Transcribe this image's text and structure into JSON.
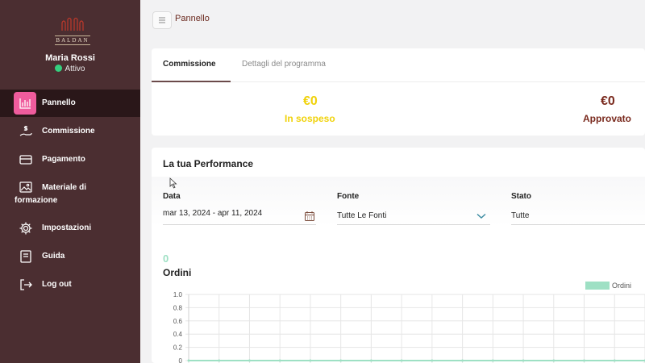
{
  "user": {
    "name": "Maria Rossi",
    "status": "Attivo"
  },
  "brand": {
    "name": "BALDAN"
  },
  "sidebar": {
    "items": [
      {
        "label": "Pannello",
        "icon": "bar-chart-icon",
        "active": true
      },
      {
        "label": "Commissione",
        "icon": "hand-money-icon"
      },
      {
        "label": "Pagamento",
        "icon": "credit-card-icon"
      },
      {
        "label": "Materiale di",
        "label_cont": "formazione",
        "icon": "image-icon"
      },
      {
        "label": "Impostazioni",
        "icon": "gear-icon"
      },
      {
        "label": "Guida",
        "icon": "book-icon"
      },
      {
        "label": "Log out",
        "icon": "logout-icon"
      }
    ]
  },
  "header": {
    "breadcrumb": "Pannello"
  },
  "commission": {
    "tabs": [
      "Commissione",
      "Dettagli del programma"
    ],
    "pending": {
      "amount": "€0",
      "label": "In sospeso",
      "color": "#f0d20a"
    },
    "approved": {
      "amount": "€0",
      "label": "Approvato",
      "color": "#7a2a1e"
    }
  },
  "performance": {
    "title": "La tua Performance",
    "filters": {
      "date": {
        "label": "Data",
        "value": "mar 13, 2024 - apr 11, 2024"
      },
      "source": {
        "label": "Fonte",
        "value": "Tutte Le Fonti"
      },
      "state": {
        "label": "Stato",
        "value": "Tutte"
      }
    },
    "orders_count": "0",
    "orders_title": "Ordini"
  },
  "chart_data": {
    "type": "line",
    "series": [
      {
        "name": "Ordini",
        "color": "#9ee0c4",
        "values": [
          0,
          0,
          0,
          0,
          0,
          0,
          0,
          0,
          0,
          0,
          0,
          0,
          0,
          0,
          0,
          0
        ]
      }
    ],
    "yticks": [
      "1.0",
      "0.8",
      "0.6",
      "0.4",
      "0.2",
      "0"
    ],
    "ylim": [
      0,
      1
    ],
    "grid": true,
    "legend": "top-right"
  }
}
